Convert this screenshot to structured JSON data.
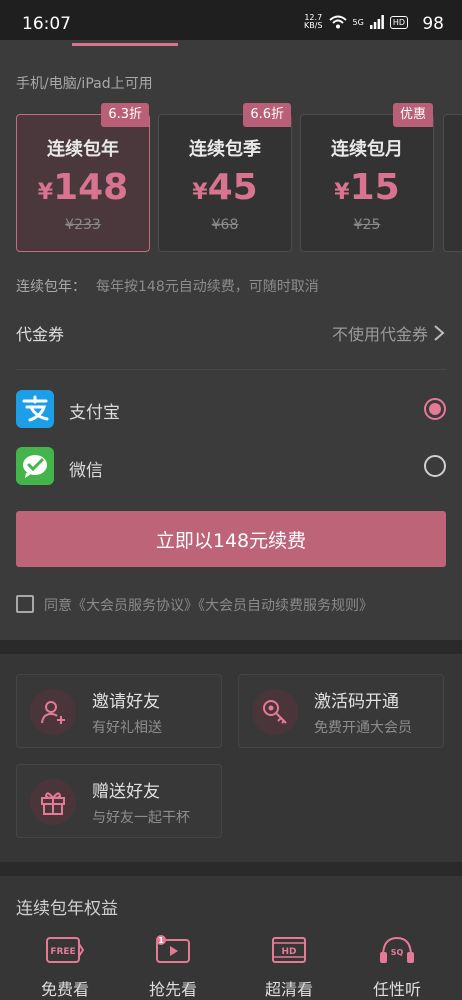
{
  "status": {
    "time": "16:07",
    "net_speed_top": "12.7",
    "net_speed_bottom": "KB/S",
    "signal": "5G",
    "hd": "HD",
    "battery": "98"
  },
  "platform_note": "手机/电脑/iPad上可用",
  "plans": [
    {
      "badge": "6.3折",
      "name": "连续包年",
      "currency": "¥",
      "price": "148",
      "original": "¥233"
    },
    {
      "badge": "6.6折",
      "name": "连续包季",
      "currency": "¥",
      "price": "45",
      "original": "¥68"
    },
    {
      "badge": "优惠",
      "name": "连续包月",
      "currency": "¥",
      "price": "15",
      "original": "¥25"
    }
  ],
  "renew": {
    "label": "连续包年：",
    "desc": "每年按148元自动续费，可随时取消"
  },
  "coupon": {
    "label": "代金券",
    "value": "不使用代金券"
  },
  "payment": {
    "alipay": "支付宝",
    "wechat": "微信",
    "selected": "alipay"
  },
  "pay_button": "立即以148元续费",
  "agreement": "同意《大会员服务协议》《大会员自动续费服务规则》",
  "features": [
    {
      "title": "邀请好友",
      "sub": "有好礼相送",
      "icon": "invite-friend-icon"
    },
    {
      "title": "激活码开通",
      "sub": "免费开通大会员",
      "icon": "key-icon"
    },
    {
      "title": "赠送好友",
      "sub": "与好友一起干杯",
      "icon": "gift-icon"
    }
  ],
  "benefits_title": "连续包年权益",
  "benefits": [
    {
      "label": "免费看",
      "icon": "free-icon",
      "icon_text": "FREE"
    },
    {
      "label": "抢先看",
      "icon": "early-access-icon",
      "icon_text": "1"
    },
    {
      "label": "超清看",
      "icon": "hd-icon",
      "icon_text": "HD"
    },
    {
      "label": "任性听",
      "icon": "sq-headphones-icon",
      "icon_text": "SQ"
    }
  ],
  "colors": {
    "accent": "#d87390",
    "button": "#bd6479",
    "badge": "#b96078"
  }
}
